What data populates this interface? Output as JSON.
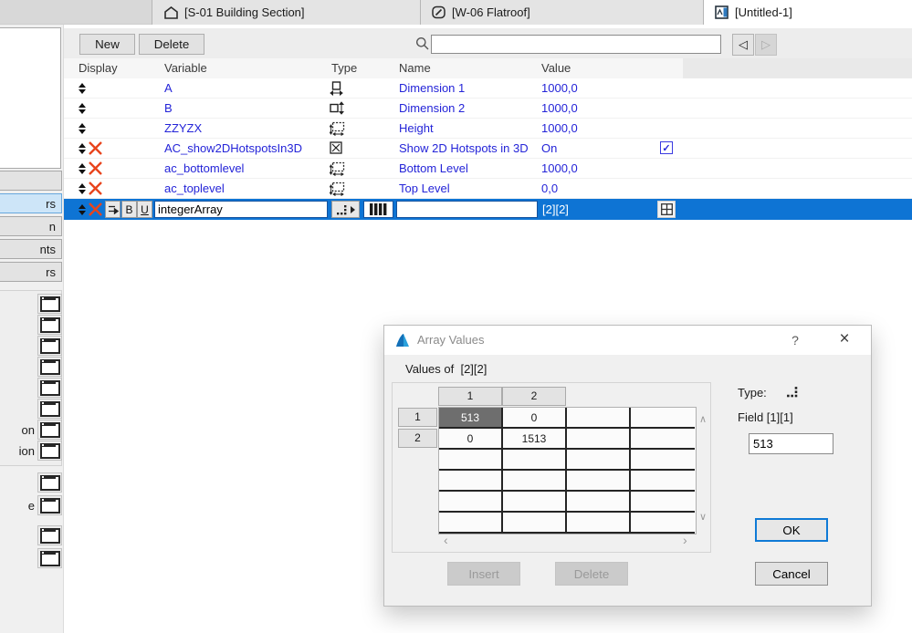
{
  "tabs": [
    {
      "label": "[S-01 Building Section]"
    },
    {
      "label": "[W-06 Flatroof]"
    },
    {
      "label": "[Untitled-1]",
      "active": true
    }
  ],
  "toolbar": {
    "new_label": "New",
    "delete_label": "Delete",
    "search_value": ""
  },
  "table": {
    "headers": {
      "display": "Display",
      "variable": "Variable",
      "type": "Type",
      "name": "Name",
      "value": "Value"
    },
    "rows": [
      {
        "variable": "A",
        "type": "length-x",
        "name": "Dimension 1",
        "value": "1000,0"
      },
      {
        "variable": "B",
        "type": "length-y",
        "name": "Dimension 2",
        "value": "1000,0"
      },
      {
        "variable": "ZZYZX",
        "type": "length-z",
        "name": "Height",
        "value": "1000,0"
      },
      {
        "variable": "AC_show2DHotspotsIn3D",
        "type": "boolean",
        "name": "Show 2D Hotspots in 3D",
        "value": "On",
        "checked": true
      },
      {
        "variable": "ac_bottomlevel",
        "type": "length-z",
        "name": "Bottom Level",
        "value": "1000,0"
      },
      {
        "variable": "ac_toplevel",
        "type": "length-z",
        "name": "Top Level",
        "value": "0,0"
      }
    ],
    "selected_row": {
      "variable_input": "integerArray",
      "bold_label": "B",
      "underline_label": "U",
      "name_input": "",
      "value": "[2][2]"
    }
  },
  "sidebar": {
    "buttons": [
      {
        "label": ""
      },
      {
        "label": "rs",
        "selected": true
      },
      {
        "label": "n"
      },
      {
        "label": "nts"
      },
      {
        "label": "rs"
      }
    ],
    "script_rows": [
      {
        "label": ""
      },
      {
        "label": ""
      },
      {
        "label": ""
      },
      {
        "label": ""
      },
      {
        "label": ""
      },
      {
        "label": ""
      },
      {
        "label": "on"
      },
      {
        "label": "ion"
      }
    ],
    "extra_rows": [
      {
        "label": ""
      },
      {
        "label": "e"
      }
    ],
    "bottom_rows": [
      {
        "label": ""
      },
      {
        "label": ""
      }
    ]
  },
  "dialog": {
    "title": "Array Values",
    "subtitle": "Values of  [2][2]",
    "grid": {
      "col_headers": [
        "1",
        "2"
      ],
      "row_headers": [
        "1",
        "2"
      ],
      "cells": [
        [
          "513",
          "0",
          "",
          ""
        ],
        [
          "0",
          "1513",
          "",
          ""
        ],
        [
          "",
          "",
          "",
          ""
        ],
        [
          "",
          "",
          "",
          ""
        ],
        [
          "",
          "",
          "",
          ""
        ],
        [
          "",
          "",
          "",
          ""
        ]
      ],
      "selected_cell": "[1][1]"
    },
    "type_label": "Type:",
    "field_label": "Field [1][1]",
    "field_value": "513",
    "ok_label": "OK",
    "cancel_label": "Cancel",
    "insert_label": "Insert",
    "delete_label": "Delete"
  },
  "icons": {
    "back": "◁",
    "forward": "▷",
    "help": "?",
    "close": "×",
    "scroll_up": "∧",
    "scroll_down": "∨",
    "scroll_left": "‹",
    "scroll_right": "›",
    "check": "✓"
  },
  "colors": {
    "selection_blue": "#0e74d4",
    "parameter_text_blue": "#2424d8",
    "delete_red": "#e8441c",
    "default_button_border": "#0f7ad6"
  }
}
